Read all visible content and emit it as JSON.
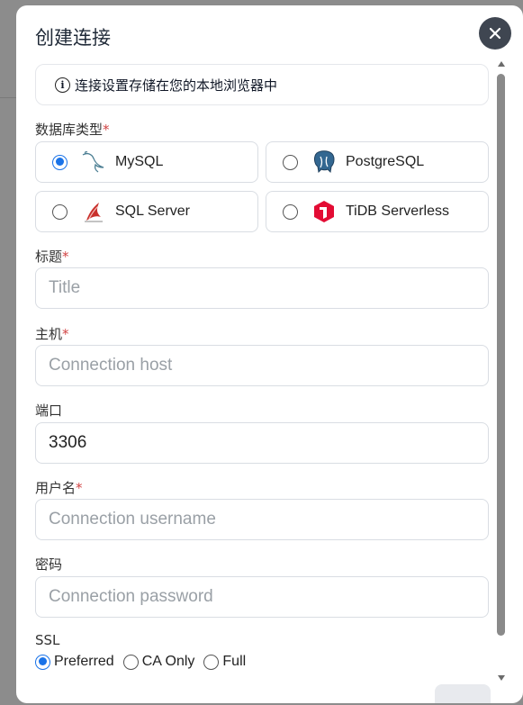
{
  "dialog": {
    "title": "创建连接",
    "close_icon": "close-icon",
    "info_text": "连接设置存储在您的本地浏览器中",
    "info_icon": "info-circle-icon"
  },
  "db_type": {
    "label": "数据库类型",
    "required_mark": "*",
    "options": [
      {
        "label": "MySQL",
        "icon": "mysql-dolphin-icon",
        "selected": true
      },
      {
        "label": "PostgreSQL",
        "icon": "postgresql-elephant-icon",
        "selected": false
      },
      {
        "label": "SQL Server",
        "icon": "sqlserver-icon",
        "selected": false
      },
      {
        "label": "TiDB Serverless",
        "icon": "tidb-icon",
        "selected": false
      }
    ]
  },
  "fields": {
    "title": {
      "label": "标题",
      "required_mark": "*",
      "placeholder": "Title",
      "value": ""
    },
    "host": {
      "label": "主机",
      "required_mark": "*",
      "placeholder": "Connection host",
      "value": ""
    },
    "port": {
      "label": "端口",
      "value": "3306"
    },
    "username": {
      "label": "用户名",
      "required_mark": "*",
      "placeholder": "Connection username",
      "value": ""
    },
    "password": {
      "label": "密码",
      "placeholder": "Connection password",
      "value": ""
    }
  },
  "ssl": {
    "label": "SSL",
    "options": [
      {
        "label": "Preferred",
        "selected": true
      },
      {
        "label": "CA Only",
        "selected": false
      },
      {
        "label": "Full",
        "selected": false
      }
    ]
  },
  "colors": {
    "accent": "#1a73e8",
    "required": "#d14343",
    "close_bg": "#3f4651"
  }
}
